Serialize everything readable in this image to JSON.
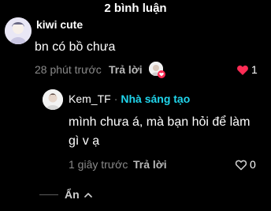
{
  "header": {
    "title": "2 bình luận"
  },
  "comment": {
    "username": "kiwi cute",
    "text": "bn có bồ chưa",
    "time": "28 phút trước",
    "reply_label": "Trả lời",
    "like_count": "1",
    "like_color": "#fe2c55"
  },
  "reply": {
    "username": "Kem_TF",
    "separator": "·",
    "creator_badge": "Nhà sáng tạo",
    "text": "mình chưa á, mà bạn hỏi để làm gì v ạ",
    "time": "1 giây trước",
    "reply_label": "Trả lời",
    "like_count": "0"
  },
  "footer": {
    "hide_label": "Ẩn"
  },
  "colors": {
    "accent": "#20d5ec",
    "background": "#000000"
  }
}
